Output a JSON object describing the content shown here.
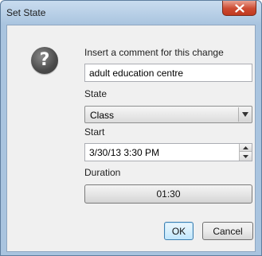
{
  "window": {
    "title": "Set State",
    "close_icon": "close-icon"
  },
  "dialog": {
    "icon": "question-icon",
    "icon_glyph": "?",
    "comment_label": "Insert a comment for this change",
    "comment_value": "adult education centre",
    "state_label": "State",
    "state_value": "Class",
    "start_label": "Start",
    "start_value": "3/30/13 3:30 PM",
    "duration_label": "Duration",
    "duration_value": "01:30"
  },
  "buttons": {
    "ok_label": "OK",
    "cancel_label": "Cancel"
  },
  "colors": {
    "frame": "#a9c4df",
    "close_button": "#c0391f",
    "ok_border": "#3c7fb1"
  }
}
